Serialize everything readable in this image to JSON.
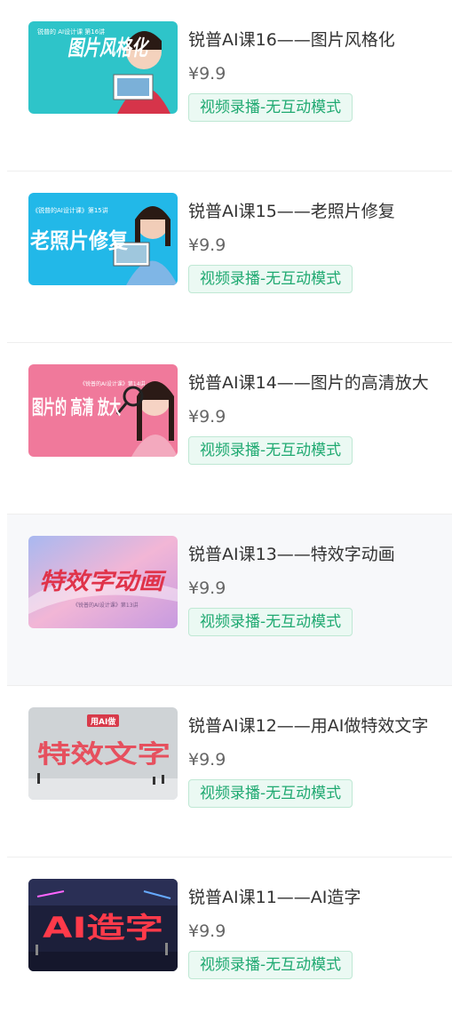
{
  "courses": [
    {
      "title": "锐普AI课16——图片风格化",
      "price": "¥9.9",
      "badge": "视频录播-无互动模式",
      "thumb": {
        "title_text": "图片风格化",
        "small_text": "锐普的 AI设计课 第16讲",
        "bg": "#2ec4c9"
      }
    },
    {
      "title": "锐普AI课15——老照片修复",
      "price": "¥9.9",
      "badge": "视频录播-无互动模式",
      "thumb": {
        "title_text": "老照片修复",
        "small_text": "《锐普的AI设计课》第15讲",
        "bg": "#22b8e8"
      }
    },
    {
      "title": "锐普AI课14——图片的高清放大",
      "price": "¥9.9",
      "badge": "视频录播-无互动模式",
      "thumb": {
        "title_text": "图片的 高清 放大",
        "small_text": "《锐普的AI设计课》第14讲",
        "bg": "#f0799b"
      }
    },
    {
      "title": "锐普AI课13——特效字动画",
      "price": "¥9.9",
      "badge": "视频录播-无互动模式",
      "thumb": {
        "title_text": "特效字动画",
        "small_text": "《锐普的AI设计课》第13讲",
        "bg": "#e9a7d4"
      },
      "highlighted": true
    },
    {
      "title": "锐普AI课12——用AI做特效文字",
      "price": "¥9.9",
      "badge": "视频录播-无互动模式",
      "thumb": {
        "title_text": "特效文字",
        "small_text": "用AI做",
        "bg": "#cfd3d6"
      }
    },
    {
      "title": "锐普AI课11——AI造字",
      "price": "¥9.9",
      "badge": "视频录播-无互动模式",
      "thumb": {
        "title_text": "AI造字",
        "small_text": "",
        "bg": "#1c1f3a"
      }
    }
  ],
  "colors": {
    "badge_text": "#1fa971",
    "badge_bg": "#ebf9f3",
    "badge_border": "#bfe8d4",
    "highlight_bg": "#f7f8fa"
  }
}
